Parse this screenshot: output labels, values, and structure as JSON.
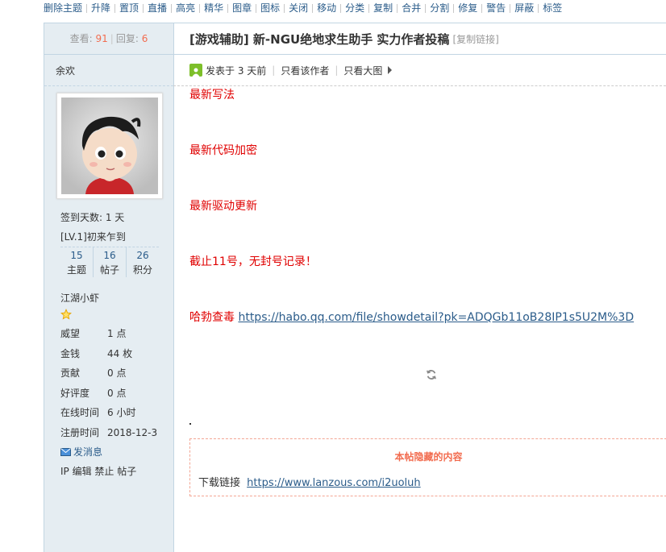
{
  "admin_toolbar": [
    "删除主题",
    "升降",
    "置顶",
    "直播",
    "高亮",
    "精华",
    "图章",
    "图标",
    "关闭",
    "移动",
    "分类",
    "复制",
    "合并",
    "分割",
    "修复",
    "警告",
    "屏蔽",
    "标签"
  ],
  "stats": {
    "views_label": "查看:",
    "views": "91",
    "replies_label": "回复:",
    "replies": "6"
  },
  "author": {
    "name": "余欢",
    "checkin": "签到天数: 1 天",
    "level": "[LV.1]初来乍到",
    "counts": [
      {
        "value": "15",
        "label": "主题"
      },
      {
        "value": "16",
        "label": "帖子"
      },
      {
        "value": "26",
        "label": "积分"
      }
    ],
    "rank": "江湖小虾",
    "fields": [
      {
        "key": "威望",
        "value": "1 点"
      },
      {
        "key": "金钱",
        "value": "44 枚"
      },
      {
        "key": "贡献",
        "value": "0 点"
      },
      {
        "key": "好评度",
        "value": "0 点"
      },
      {
        "key": "在线时间",
        "value": "6 小时"
      },
      {
        "key": "注册时间",
        "value": "2018-12-3"
      }
    ],
    "send_message": "发消息",
    "admin_links": "IP 编辑 禁止 帖子"
  },
  "post": {
    "title": "[游戏辅助] 新-NGU绝地求生助手 实力作者投稿",
    "copy_link": "[复制链接]",
    "posted": "发表于 3 天前",
    "only_author": "只看该作者",
    "only_images": "只看大图",
    "lines": [
      "最新写法",
      "最新代码加密",
      "最新驱动更新",
      "截止11号，无封号记录！"
    ],
    "scan_label": "哈勃查毒",
    "scan_url": "https://habo.qq.com/file/showdetail?pk=ADQGb11oB28IP1s5U2M%3D",
    "hidden_title": "本帖隐藏的内容",
    "download_label": "下载链接",
    "download_url": "https://www.lanzous.com/i2uoluh"
  },
  "colors": {
    "link": "#2b5c8a",
    "post_text": "#e00000",
    "hidden_title": "#f26c4f",
    "sidebar_bg": "#e5edf2"
  }
}
